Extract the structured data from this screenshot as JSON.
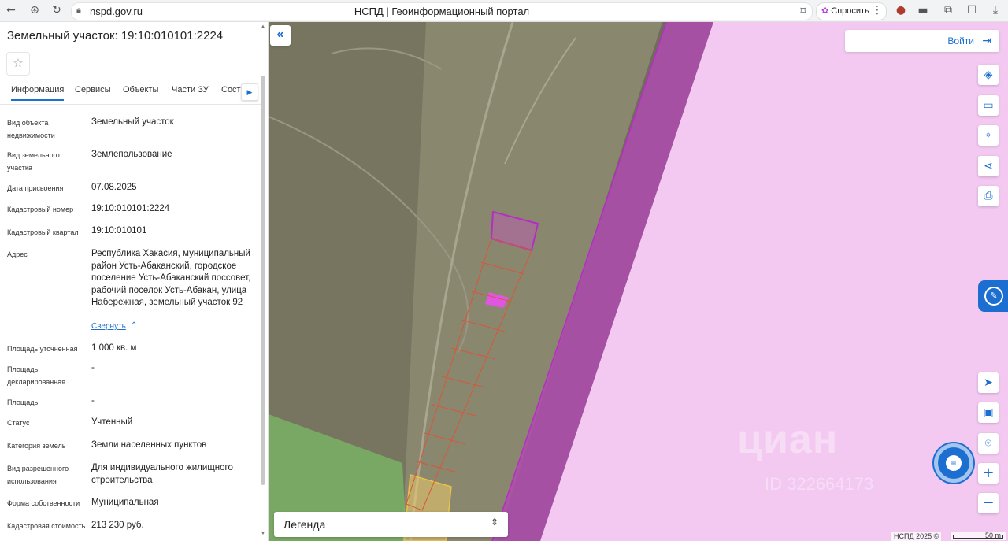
{
  "browser": {
    "url": "nspd.gov.ru",
    "tab_title": "НСПД | Геоинформационный портал",
    "ask_label": "Спросить"
  },
  "panel": {
    "title": "Земельный участок: 19:10:010101:2224",
    "tabs": [
      "Информация",
      "Сервисы",
      "Объекты",
      "Части ЗУ",
      "Соста"
    ],
    "rows": [
      {
        "label": "Вид объекта недвижимости",
        "value": "Земельный участок"
      },
      {
        "label": "Вид земельного участка",
        "value": "Землепользование"
      },
      {
        "label": "Дата присвоения",
        "value": "07.08.2025"
      },
      {
        "label": "Кадастровый номер",
        "value": "19:10:010101:2224"
      },
      {
        "label": "Кадастровый квартал",
        "value": "19:10:010101"
      },
      {
        "label": "Адрес",
        "value": "Республика Хакасия, муниципальный район Усть-Абаканский, городское поселение Усть-Абаканский поссовет, рабочий поселок Усть-Абакан, улица Набережная, земельный участок 92"
      },
      {
        "label": "Площадь уточненная",
        "value": "1 000 кв. м"
      },
      {
        "label": "Площадь декларированная",
        "value": "-"
      },
      {
        "label": "Площадь",
        "value": "-"
      },
      {
        "label": "Статус",
        "value": "Учтенный"
      },
      {
        "label": "Категория земель",
        "value": "Земли населенных пунктов"
      },
      {
        "label": "Вид разрешенного использования",
        "value": "Для индивидуального жилищного строительства"
      },
      {
        "label": "Форма собственности",
        "value": "Муниципальная"
      },
      {
        "label": "Кадастровая стоимость",
        "value": "213 230 руб."
      }
    ],
    "collapse_label": "Свернуть"
  },
  "map": {
    "login_label": "Войти",
    "legend_label": "Легенда",
    "copyright": "НСПД 2025 ©",
    "scale_label": "50 m",
    "watermark": "циан",
    "watermark_id": "ID 322664173"
  },
  "colors": {
    "accent": "#1c6fd1",
    "parcel_fill": "#f3c9f2",
    "parcel_border": "#b32fc0",
    "plot_outline": "#d8563a",
    "green_zone": "#7bd36a",
    "yellow_plot": "#f4d06a"
  },
  "icons": {
    "back": "arrow-left-icon",
    "shield": "shield-icon",
    "reload": "reload-icon",
    "layers": "layers-icon",
    "ruler": "ruler-icon",
    "select_area": "select-area-icon",
    "share": "share-icon",
    "print": "print-icon",
    "locate": "locate-icon",
    "minimap": "minimap-icon",
    "pin": "pin-icon",
    "zoom_in": "zoom-in-icon",
    "zoom_out": "zoom-out-icon"
  }
}
